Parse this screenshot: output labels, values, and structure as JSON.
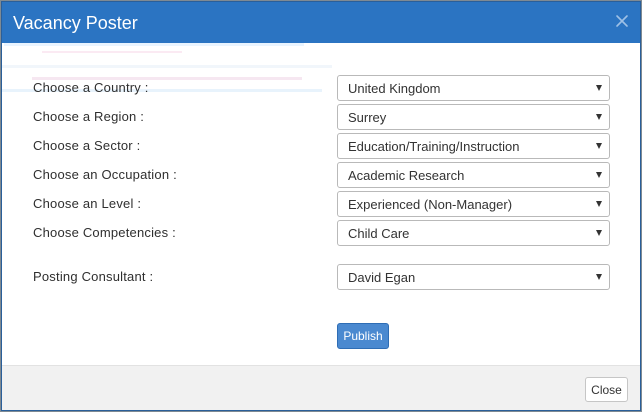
{
  "modal": {
    "title": "Vacancy Poster",
    "close_icon": "close-icon"
  },
  "form": {
    "fields": [
      {
        "key": "country",
        "label": "Choose a Country :",
        "value": "United Kingdom"
      },
      {
        "key": "region",
        "label": "Choose a Region :",
        "value": "Surrey"
      },
      {
        "key": "sector",
        "label": "Choose a Sector :",
        "value": "Education/Training/Instruction"
      },
      {
        "key": "occupation",
        "label": "Choose an Occupation :",
        "value": "Academic Research"
      },
      {
        "key": "level",
        "label": "Choose an Level :",
        "value": "Experienced (Non-Manager)"
      },
      {
        "key": "competencies",
        "label": "Choose Competencies :",
        "value": "Child Care"
      },
      {
        "key": "consultant",
        "label": "Posting Consultant :",
        "value": "David Egan"
      }
    ],
    "publish_label": "Publish",
    "caret_icon": "chevron-down-icon"
  },
  "footer": {
    "close_label": "Close"
  },
  "colors": {
    "header": "#2b74c2",
    "publish": "#4a89d0",
    "footer": "#f1f1f1"
  }
}
